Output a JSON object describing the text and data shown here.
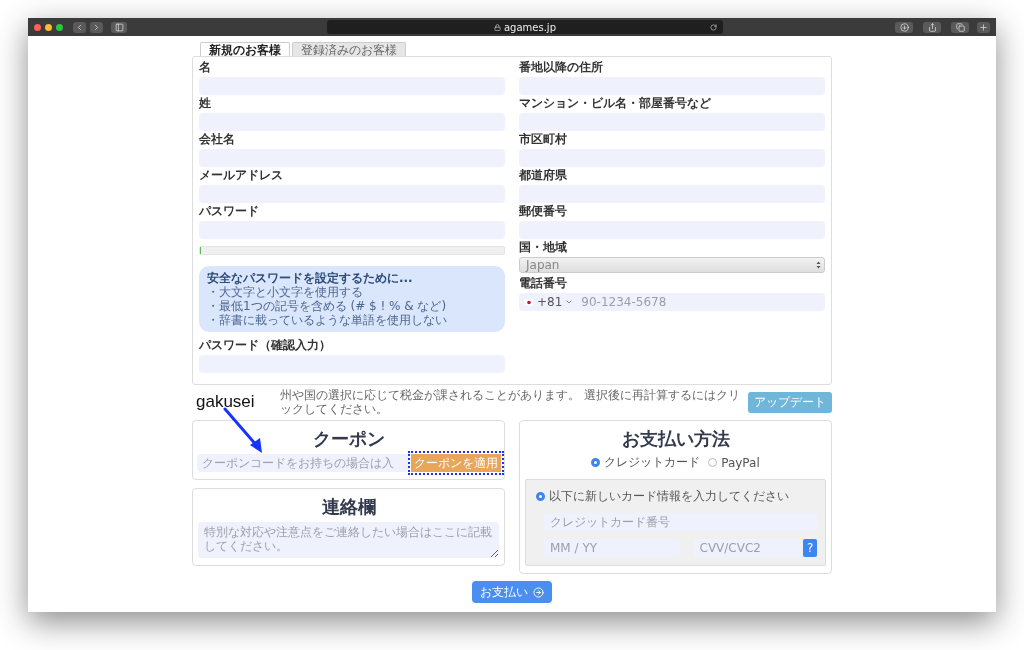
{
  "browser": {
    "address": "agames.jp"
  },
  "tabs": [
    {
      "label": "新規のお客様",
      "selected": true
    },
    {
      "label": "登録済みのお客様",
      "selected": false
    }
  ],
  "form": {
    "left": [
      {
        "kind": "text",
        "label": "名"
      },
      {
        "kind": "text",
        "label": "姓"
      },
      {
        "kind": "text",
        "label": "会社名"
      },
      {
        "kind": "text",
        "label": "メールアドレス"
      },
      {
        "kind": "text",
        "label": "パスワード"
      },
      {
        "kind": "strength",
        "level": 0
      },
      {
        "kind": "hint",
        "title": "安全なパスワードを設定するために...",
        "items": [
          "・大文字と小文字を使用する",
          "・最低1つの記号を含める (# $ ! % & など)",
          "・辞書に載っているような単語を使用しない"
        ]
      },
      {
        "kind": "text",
        "label": "パスワード（確認入力）"
      }
    ],
    "right": [
      {
        "kind": "text",
        "label": "番地以降の住所"
      },
      {
        "kind": "text",
        "label": "マンション・ビル名・部屋番号など"
      },
      {
        "kind": "text",
        "label": "市区町村"
      },
      {
        "kind": "text",
        "label": "都道府県"
      },
      {
        "kind": "text",
        "label": "郵便番号"
      },
      {
        "kind": "select",
        "label": "国・地域",
        "value": "Japan"
      },
      {
        "kind": "phone",
        "label": "電話番号",
        "code": "+81",
        "placeholder": "90-1234-5678"
      }
    ]
  },
  "annotation": "gakusei",
  "tax": {
    "text": "州や国の選択に応じて税金が課されることがあります。 選択後に再計算するにはクリックしてください。",
    "button": "アップデート"
  },
  "coupon": {
    "title": "クーポン",
    "placeholder": "クーポンコードをお持ちの場合は入",
    "button": "クーポンを適用"
  },
  "notes": {
    "title": "連絡欄",
    "placeholder": "特別な対応や注意点をご連絡したい場合はここに記載してください。"
  },
  "payment": {
    "title": "お支払い方法",
    "methods": [
      {
        "label": "クレジットカード",
        "selected": true
      },
      {
        "label": "PayPal",
        "selected": false
      }
    ],
    "card_option": {
      "label": "以下に新しいカード情報を入力してください",
      "selected": true
    },
    "card_number": {
      "placeholder": "クレジットカード番号"
    },
    "expiry": {
      "placeholder": "MM / YY"
    },
    "cvv": {
      "placeholder": "CVV/CVC2"
    },
    "cvv_help": "?"
  },
  "submit": "お支払い"
}
